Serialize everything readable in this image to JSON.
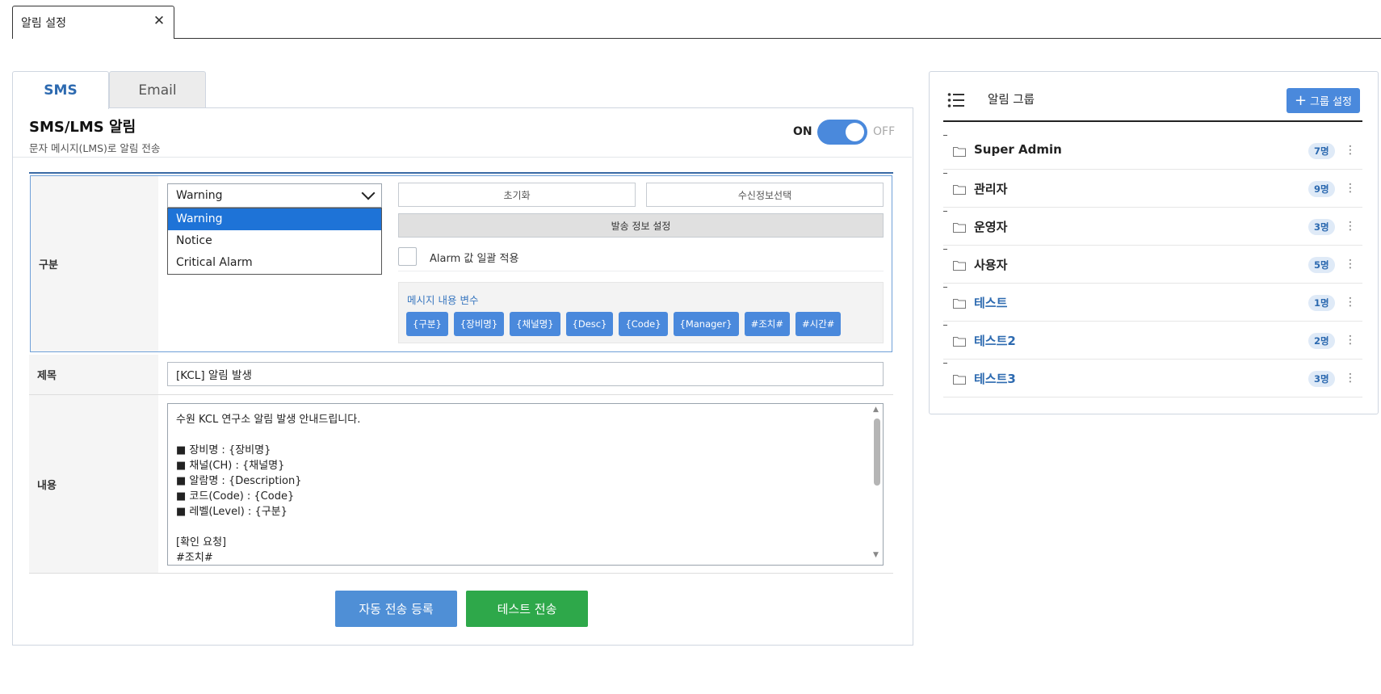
{
  "page_tab": {
    "label": "알림 설정",
    "close_icon": "close-icon"
  },
  "tabs": [
    {
      "label": "SMS",
      "active": true
    },
    {
      "label": "Email",
      "active": false
    }
  ],
  "panel": {
    "title": "SMS/LMS 알림",
    "subtitle": "문자 메시지(LMS)로 알림 전송",
    "toggle": {
      "on_label": "ON",
      "off_label": "OFF",
      "state": "on",
      "color": "#4a89dc"
    }
  },
  "form": {
    "gubun": {
      "label": "구분",
      "selected": "Warning",
      "options": [
        "Warning",
        "Notice",
        "Critical Alarm"
      ],
      "reset_button": "초기화",
      "recipient_button": "수신정보선택",
      "send_info_button": "발송 정보 설정",
      "bulk_apply_label": "Alarm 값 일괄 적용",
      "variables_title": "메시지 내용 변수",
      "variables": [
        "{구분}",
        "{장비명}",
        "{채널명}",
        "{Desc}",
        "{Code}",
        "{Manager}",
        "#조치#",
        "#시간#"
      ]
    },
    "subject": {
      "label": "제목",
      "value": "[KCL] 알림 발생"
    },
    "content": {
      "label": "내용",
      "value": "수원 KCL 연구소 알림 발생 안내드립니다.\n\n■ 장비명 : {장비명}\n■ 채널(CH) : {채널명}\n■ 알람명 : {Description}\n■ 코드(Code) : {Code}\n■ 레벨(Level) : {구분}\n\n[확인 요청]\n#조치#"
    }
  },
  "actions": {
    "auto_register": "자동 전송 등록",
    "test_send": "테스트 전송",
    "auto_color": "#4f8fd6",
    "test_color": "#2ea84a"
  },
  "groups_panel": {
    "title": "알림 그룹",
    "settings_button": "그룹 설정",
    "groups": [
      {
        "name": "Super Admin",
        "count": "7명",
        "highlight": false
      },
      {
        "name": "관리자",
        "count": "9명",
        "highlight": false
      },
      {
        "name": "운영자",
        "count": "3명",
        "highlight": false
      },
      {
        "name": "사용자",
        "count": "5명",
        "highlight": false
      },
      {
        "name": "테스트",
        "count": "1명",
        "highlight": true
      },
      {
        "name": "테스트2",
        "count": "2명",
        "highlight": true
      },
      {
        "name": "테스트3",
        "count": "3명",
        "highlight": true
      }
    ]
  }
}
